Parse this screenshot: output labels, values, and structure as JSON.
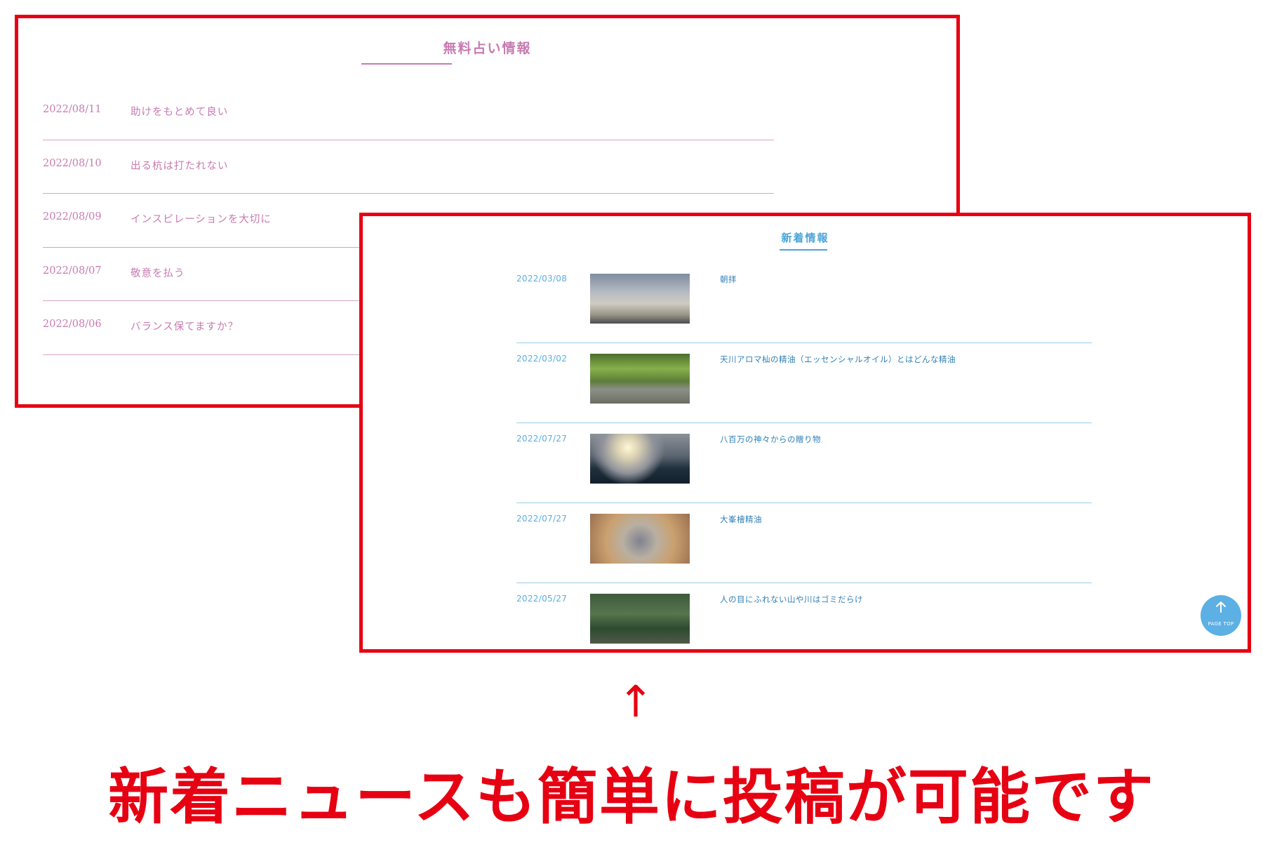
{
  "fortune": {
    "title": "無料占い情報",
    "items": [
      {
        "date": "2022/08/11",
        "text": "助けをもとめて良い"
      },
      {
        "date": "2022/08/10",
        "text": "出る杭は打たれない"
      },
      {
        "date": "2022/08/09",
        "text": "インスピレーションを大切に"
      },
      {
        "date": "2022/08/07",
        "text": "敬意を払う"
      },
      {
        "date": "2022/08/06",
        "text": "バランス保てますか？"
      }
    ]
  },
  "news": {
    "title": "新着情報",
    "items": [
      {
        "date": "2022/03/08",
        "text": "朝拝"
      },
      {
        "date": "2022/03/02",
        "text": "天川アロマ杣の精油（エッセンシャルオイル）とはどんな精油"
      },
      {
        "date": "2022/07/27",
        "text": "八百万の神々からの贈り物"
      },
      {
        "date": "2022/07/27",
        "text": "大峯檜精油"
      },
      {
        "date": "2022/05/27",
        "text": "人の目にふれない山や川はゴミだらけ"
      }
    ],
    "page_top": {
      "icon": "up-arrow-icon",
      "label": "PAGE TOP"
    }
  },
  "annotation": {
    "arrow": "↑",
    "caption": "新着ニュースも簡単に投稿が可能です"
  },
  "colors": {
    "frame": "#e60012",
    "fortune_accent": "#c77bb1",
    "news_accent": "#4aa4d8",
    "caption": "#e60012"
  }
}
